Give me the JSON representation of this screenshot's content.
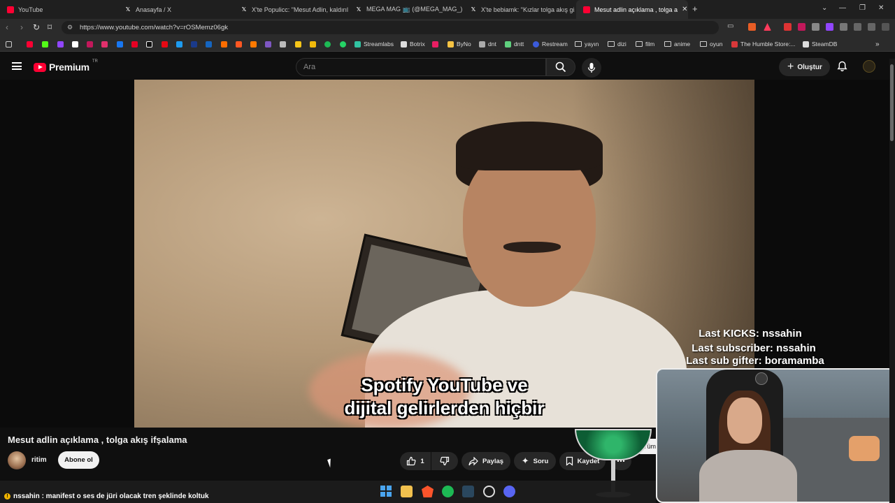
{
  "browser": {
    "tabs": [
      {
        "title": "YouTube",
        "icon": "youtube-icon"
      },
      {
        "title": "Anasayfa / X",
        "icon": "x-icon"
      },
      {
        "title": "X'te Populicc: \"Mesut Adlin, kaldırılan",
        "icon": "x-icon"
      },
      {
        "title": "MEGA MAG 📺 (@MEGA_MAG_) / X",
        "icon": "x-icon"
      },
      {
        "title": "X'te bebiamk: \"Kızlar tolga akış gizem",
        "icon": "x-icon"
      },
      {
        "title": "Mesut adlin açıklama , tolga a",
        "icon": "youtube-icon",
        "active": true
      }
    ],
    "url": "https://www.youtube.com/watch?v=rOSMemz06gk",
    "bookmarks": [
      {
        "label": "Streamlabs",
        "color": "#31c3a2"
      },
      {
        "label": "Botrix",
        "color": "#dddddd"
      },
      {
        "label": "ByNo",
        "color": "#f6c343"
      },
      {
        "label": "dnt",
        "color": "#aaaaaa"
      },
      {
        "label": "dntt",
        "color": "#5fd07e"
      },
      {
        "label": "Restream",
        "color": "#3b5bdb"
      },
      {
        "label": "yayın",
        "folder": true
      },
      {
        "label": "dizi",
        "folder": true
      },
      {
        "label": "film",
        "folder": true
      },
      {
        "label": "anime",
        "folder": true
      },
      {
        "label": "oyun",
        "folder": true
      },
      {
        "label": "The Humble Store:...",
        "color": "#d9383a"
      },
      {
        "label": "SteamDB",
        "color": "#dddddd"
      }
    ]
  },
  "youtube": {
    "logo_text": "Premium",
    "logo_region": "TR",
    "search_placeholder": "Ara",
    "create_label": "Oluştur"
  },
  "video": {
    "subtitle_line1": "Spotify YouTube ve",
    "subtitle_line2": "dijital gelirlerden hiçbir",
    "title": "Mesut adlin açıklama , tolga akış ifşalama",
    "channel": "ritim",
    "subscribe_label": "Abone ol",
    "likes": "1",
    "share_label": "Paylaş",
    "ask_label": "Soru",
    "save_label": "Kaydet",
    "side_chip": "Tüm"
  },
  "overlay": {
    "last_kicks": "Last KICKS: nssahin",
    "last_subscriber": "Last subscriber: nssahin",
    "last_sub_gifter": "Last sub gifter: boramamba",
    "chat_message": "nssahin : manifest o ses de jüri olacak tren şeklinde koltuk"
  },
  "colors": {
    "youtube_red": "#ff0033",
    "background": "#0f0f0f",
    "pill": "#272727"
  }
}
